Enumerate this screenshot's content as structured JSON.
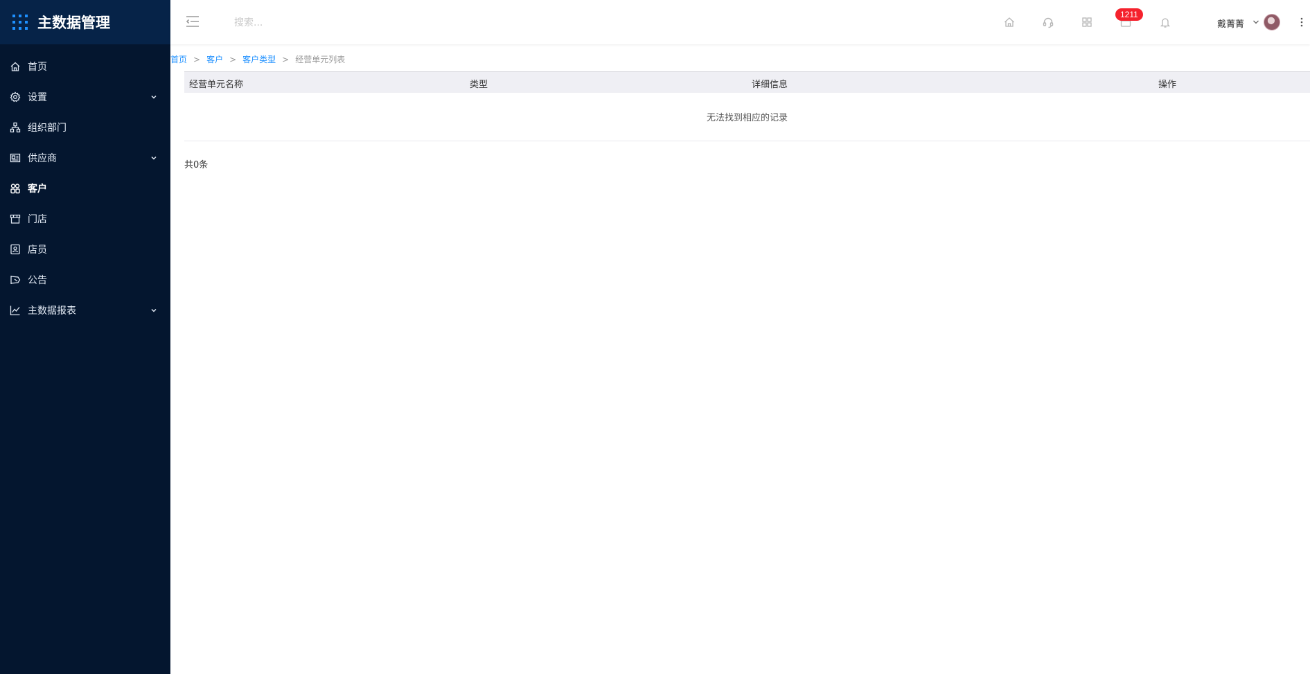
{
  "app": {
    "title": "主数据管理",
    "accent": "#1e90ff",
    "sidebar_bg": "#04162f"
  },
  "sidebar": {
    "items": [
      {
        "label": "首页",
        "icon": "home-icon",
        "has_children": false
      },
      {
        "label": "设置",
        "icon": "gear-icon",
        "has_children": true
      },
      {
        "label": "组织部门",
        "icon": "org-tree-icon",
        "has_children": false
      },
      {
        "label": "供应商",
        "icon": "vendor-card-icon",
        "has_children": true
      },
      {
        "label": "客户",
        "icon": "customer-icon",
        "has_children": false,
        "active": true
      },
      {
        "label": "门店",
        "icon": "store-icon",
        "has_children": false
      },
      {
        "label": "店员",
        "icon": "staff-badge-icon",
        "has_children": false
      },
      {
        "label": "公告",
        "icon": "announcement-icon",
        "has_children": false
      },
      {
        "label": "主数据报表",
        "icon": "line-chart-icon",
        "has_children": true
      }
    ]
  },
  "header": {
    "search_placeholder": "搜索...",
    "badge_count": "1211",
    "user_name": "戴菁菁"
  },
  "breadcrumb": {
    "items": [
      "首页",
      "客户",
      "客户类型"
    ],
    "current": "经营单元列表",
    "separator": ">"
  },
  "table": {
    "columns": [
      "经营单元名称",
      "类型",
      "详细信息",
      "操作"
    ],
    "empty_text": "无法找到相应的记录",
    "total_text": "共0条"
  }
}
